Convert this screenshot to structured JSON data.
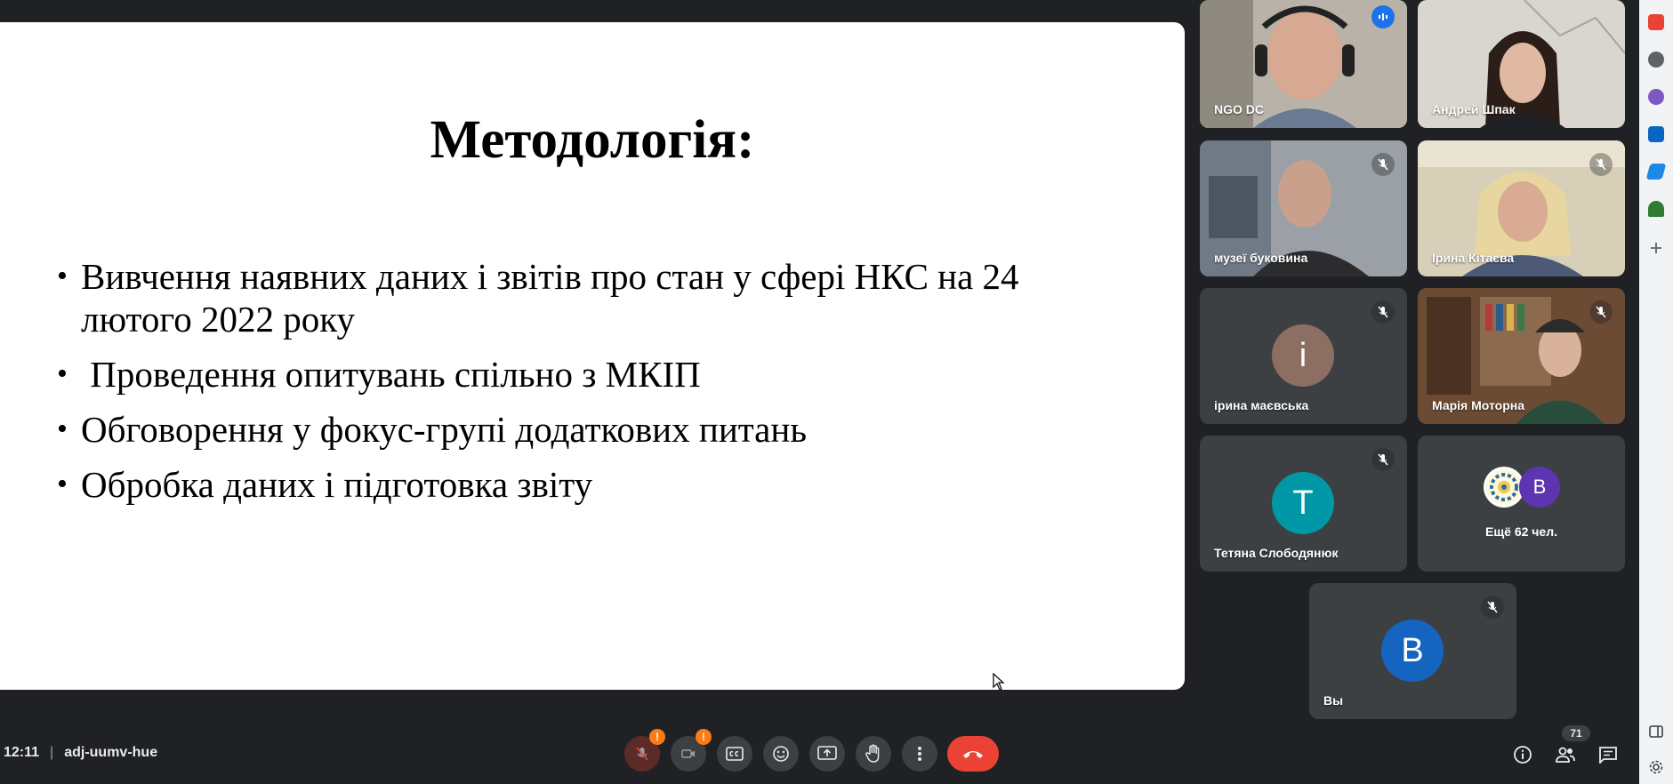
{
  "slide": {
    "title": "Методологія:",
    "bullet_marker": "•",
    "bullets": [
      "Вивчення наявних даних і звітів про стан у сфері НКС на 24 лютого 2022 року",
      " Проведення опитувань спільно з МКІП",
      "Обговорення у фокус-групі додаткових питань",
      "Обробка даних і підготовка звіту"
    ]
  },
  "participants": [
    {
      "name": "NGO DC"
    },
    {
      "name": "Андрей Шпак"
    },
    {
      "name": "музеї буковина"
    },
    {
      "name": "Ірина Кітаєва"
    },
    {
      "name": "ірина маєвська",
      "initial": "i",
      "color": "#8d6e63"
    },
    {
      "name": "Марія Моторна"
    },
    {
      "name": "Тетяна Слободянюк",
      "initial": "T",
      "color": "#0097a7"
    }
  ],
  "more": {
    "label": "Ещё 62 чел.",
    "initial": "B",
    "color": "#5e35b1"
  },
  "self": {
    "name": "Вы",
    "initial": "B",
    "color": "#1565c0"
  },
  "meeting": {
    "time": "12:11",
    "separator": "|",
    "code": "adj-uumv-hue"
  },
  "controls": {
    "warn": "!",
    "participants_count": "71"
  },
  "colors": {
    "end_call": "#ea4335",
    "warning": "#fa7b17",
    "active_border": "#8ab4f8"
  }
}
